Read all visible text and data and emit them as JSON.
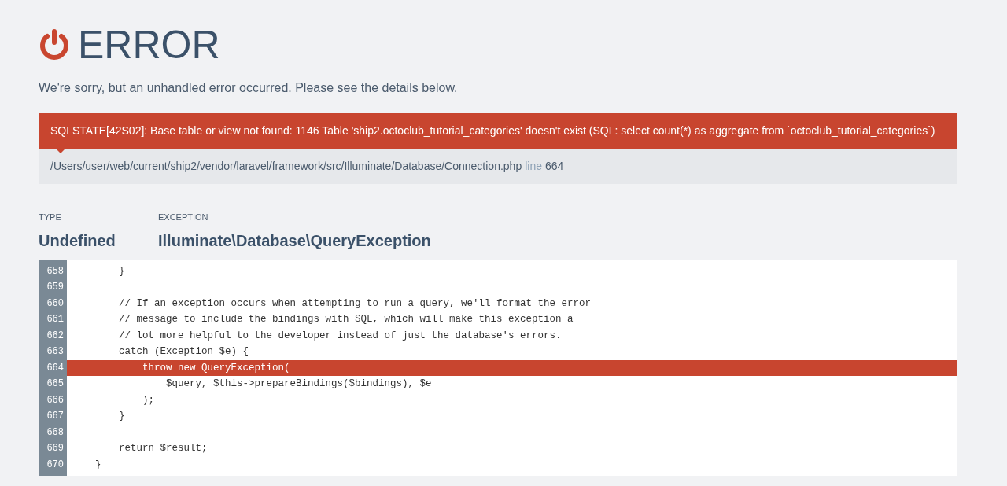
{
  "header": {
    "title": "ERROR",
    "subtitle": "We're sorry, but an unhandled error occurred. Please see the details below."
  },
  "error": {
    "message": "SQLSTATE[42S02]: Base table or view not found: 1146 Table 'ship2.octoclub_tutorial_categories' doesn't exist (SQL: select count(*) as aggregate from `octoclub_tutorial_categories`)",
    "file": "/Users/user/web/current/ship2/vendor/laravel/framework/src/Illuminate/Database/Connection.php",
    "line_label": "line",
    "line": "664"
  },
  "details": [
    {
      "label": "TYPE",
      "value": "Undefined"
    },
    {
      "label": "EXCEPTION",
      "value": "Illuminate\\Database\\QueryException"
    }
  ],
  "code": [
    {
      "number": "658",
      "text": "        }",
      "highlighted": false
    },
    {
      "number": "659",
      "highlighted": false
    },
    {
      "number": "660",
      "text": "        // If an exception occurs when attempting to run a query, we'll format the error",
      "highlighted": false
    },
    {
      "number": "661",
      "text": "        // message to include the bindings with SQL, which will make this exception a",
      "highlighted": false
    },
    {
      "number": "662",
      "text": "        // lot more helpful to the developer instead of just the database's errors.",
      "highlighted": false
    },
    {
      "number": "663",
      "text": "        catch (Exception $e) {",
      "highlighted": false
    },
    {
      "number": "664",
      "text": "            throw new QueryException(",
      "highlighted": true
    },
    {
      "number": "665",
      "text": "                $query, $this->prepareBindings($bindings), $e",
      "highlighted": false
    },
    {
      "number": "666",
      "text": "            );",
      "highlighted": false
    },
    {
      "number": "667",
      "text": "        }",
      "highlighted": false
    },
    {
      "number": "668",
      "highlighted": false
    },
    {
      "number": "669",
      "text": "        return $result;",
      "highlighted": false
    },
    {
      "number": "670",
      "text": "    }",
      "highlighted": false
    }
  ]
}
